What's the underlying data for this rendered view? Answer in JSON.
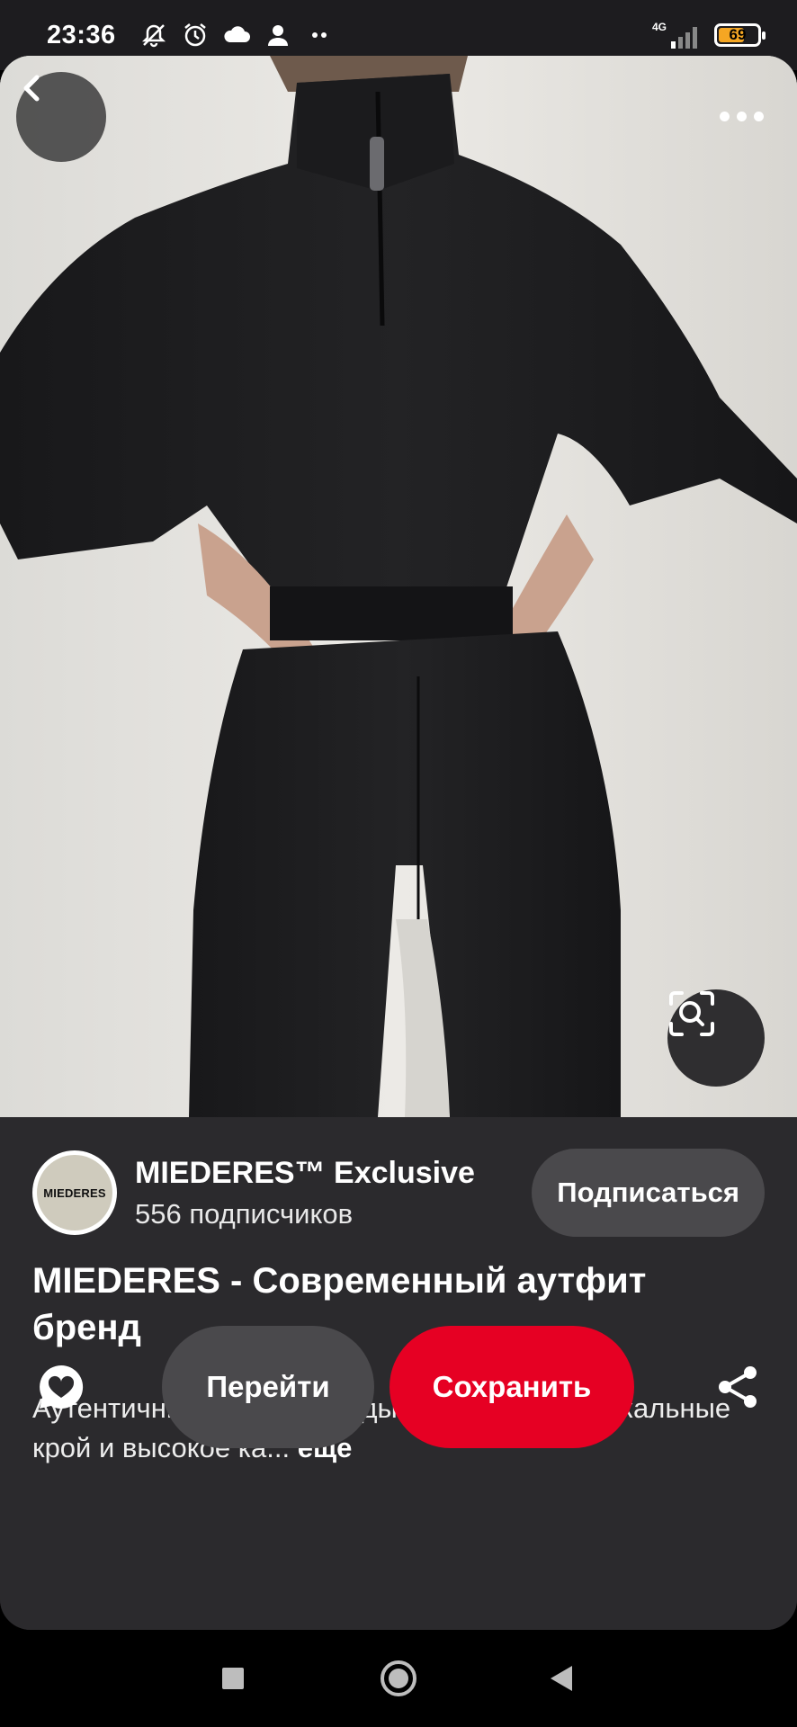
{
  "status_bar": {
    "time": "23:36",
    "network": "4G",
    "battery_level": "69",
    "battery_fraction": 0.69,
    "icons": [
      "mute-icon",
      "alarm-icon",
      "cloud-icon",
      "person-icon",
      "dots-icon",
      "signal-icon",
      "battery-icon"
    ]
  },
  "pin": {
    "creator": {
      "avatar_text": "MIEDERES",
      "name": "MIEDERES™ Exclusive",
      "followers": "556 подписчиков"
    },
    "subscribe_label": "Подписаться",
    "title": "MIEDERES - Современный аутфит бренд",
    "description": "Аутентичный бренд одежды MIEDERES - уникальные крой и высокое ка...",
    "more_label": "еще"
  },
  "actions": {
    "visit_label": "Перейти",
    "save_label": "Сохранить"
  },
  "colors": {
    "accent": "#e60023",
    "card_bg": "#2b2a2d",
    "button_bg": "#4a494c"
  }
}
